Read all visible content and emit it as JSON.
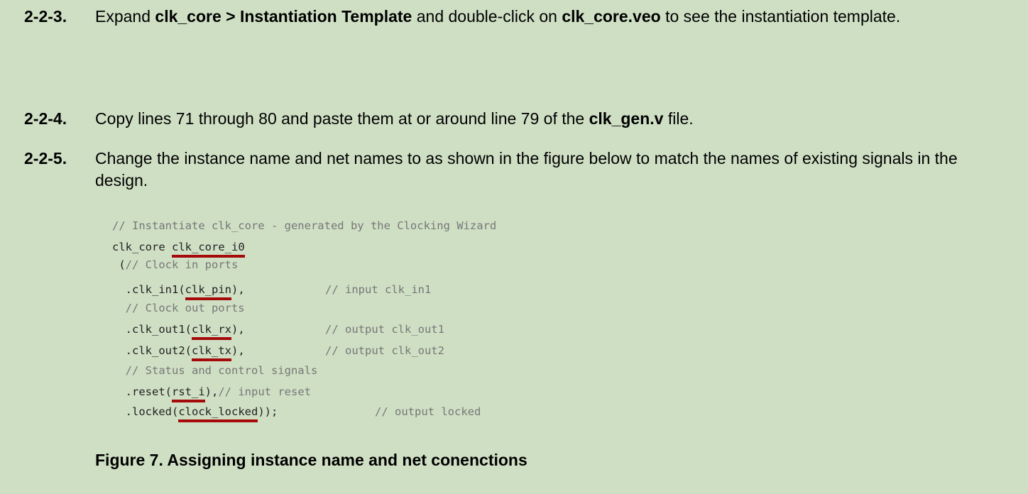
{
  "steps": [
    {
      "num": "2-2-3.",
      "parts": [
        {
          "t": "Expand ",
          "b": false
        },
        {
          "t": "clk_core > Instantiation Template",
          "b": true
        },
        {
          "t": " and double-click on ",
          "b": false
        },
        {
          "t": "clk_core.veo",
          "b": true
        },
        {
          "t": " to see the instantiation template.",
          "b": false
        }
      ]
    },
    {
      "num": "2-2-4.",
      "parts": [
        {
          "t": "Copy lines 71 through 80 and paste them at or around line 79 of the ",
          "b": false
        },
        {
          "t": "clk_gen.v",
          "b": true
        },
        {
          "t": " file.",
          "b": false
        }
      ]
    },
    {
      "num": "2-2-5.",
      "parts": [
        {
          "t": "Change the instance name and net names to as shown in the figure below to match the names of existing signals in the design.",
          "b": false
        }
      ]
    }
  ],
  "code": {
    "l1": "// Instantiate clk_core - generated by the Clocking Wizard",
    "l2a": "clk_core ",
    "l2b": "clk_core_i0",
    "l3a": " (",
    "l3b": "// Clock in ports",
    "l4a": "  .clk_in1(",
    "l4b": "clk_pin",
    "l4c": "),",
    "l4d": "// input clk_in1",
    "l5": "  // Clock out ports",
    "l6a": "  .clk_out1(",
    "l6b": "clk_rx",
    "l6c": "),",
    "l6d": "// output clk_out1",
    "l7a": "  .clk_out2(",
    "l7b": "clk_tx",
    "l7c": "),",
    "l7d": "// output clk_out2",
    "l8": "  // Status and control signals",
    "l9a": "  .reset(",
    "l9b": "rst_i",
    "l9c": "),",
    "l9d": "// input reset",
    "l10a": "  .locked(",
    "l10b": "clock_locked",
    "l10c": "));",
    "l10d": "// output locked"
  },
  "caption": "Figure 7. Assigning instance name and net conenctions"
}
